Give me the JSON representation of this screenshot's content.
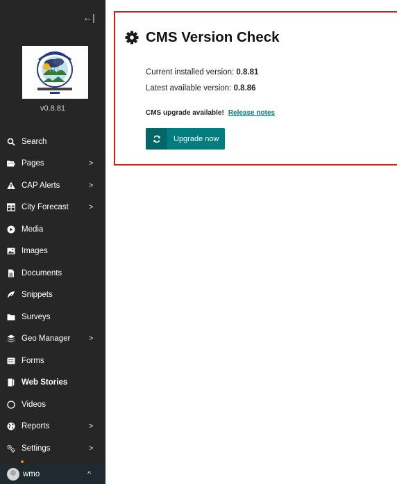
{
  "sidebar": {
    "collapse_label": "←|",
    "version": "v0.8.81",
    "items": [
      {
        "label": "Search",
        "icon": "search-icon",
        "chevron": false
      },
      {
        "label": "Pages",
        "icon": "folder-open-icon",
        "chevron": true
      },
      {
        "label": "CAP Alerts",
        "icon": "warning-icon",
        "chevron": true
      },
      {
        "label": "City Forecast",
        "icon": "table-icon",
        "chevron": true
      },
      {
        "label": "Media",
        "icon": "play-icon",
        "chevron": false
      },
      {
        "label": "Images",
        "icon": "image-icon",
        "chevron": false
      },
      {
        "label": "Documents",
        "icon": "document-icon",
        "chevron": false
      },
      {
        "label": "Snippets",
        "icon": "snippet-icon",
        "chevron": false
      },
      {
        "label": "Surveys",
        "icon": "folder-icon",
        "chevron": false
      },
      {
        "label": "Geo Manager",
        "icon": "layers-icon",
        "chevron": true
      },
      {
        "label": "Forms",
        "icon": "form-icon",
        "chevron": false
      },
      {
        "label": "Web Stories",
        "icon": "web-stories-icon",
        "chevron": false,
        "active": true
      },
      {
        "label": "Videos",
        "icon": "circle-icon",
        "chevron": false
      },
      {
        "label": "Reports",
        "icon": "globe-icon",
        "chevron": true
      },
      {
        "label": "Settings",
        "icon": "cogs-icon",
        "chevron": true
      }
    ],
    "chevron_glyph": ">",
    "user": {
      "name": "wmo",
      "chevron": "^"
    }
  },
  "main": {
    "title": "CMS Version Check",
    "current_label": "Current installed version: ",
    "current_version": "0.8.81",
    "latest_label": "Latest available version: ",
    "latest_version": "0.8.86",
    "upgrade_notice": "CMS upgrade available!",
    "release_notes": "Release notes",
    "upgrade_button": "Upgrade now"
  },
  "colors": {
    "sidebar_bg": "#262626",
    "accent": "#007d7e",
    "panel_border": "#cc1f1f"
  }
}
